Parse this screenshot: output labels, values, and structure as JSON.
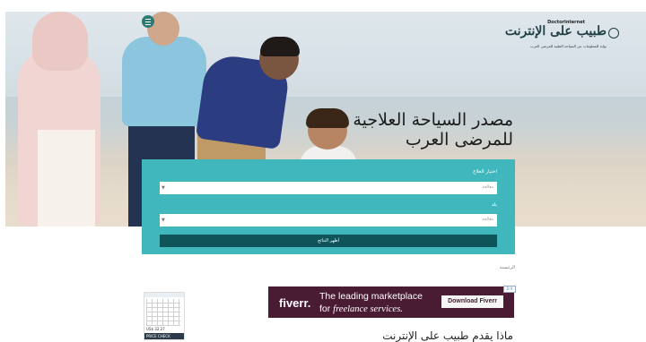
{
  "header": {
    "logo_en": "DoctorInternet",
    "logo_ar": "طبيب على الإنترنت",
    "tagline": "بوابة للمعلومات عن السياحة الطبية للمرضى العرب",
    "menu_icon": "hamburger-icon"
  },
  "hero": {
    "title_line1": "مصدر السياحة العلاجية",
    "title_line2": "للمرضى العرب"
  },
  "search": {
    "treatment_label": "اختيار العلاج",
    "treatment_placeholder": "معالجة",
    "country_label": "بلد",
    "country_placeholder": "معالجة",
    "submit_label": "أظهر النتائج",
    "caret_icon": "chevron-down-icon",
    "panel_color": "#3fb7bd",
    "button_color": "#0e5459"
  },
  "breadcrumb": "الرئيسية",
  "widget": {
    "price_text": "US$ 32.27",
    "bar_text": "PRICE CHECK"
  },
  "ad": {
    "brand": "fiverr.",
    "line1": "The leading marketplace",
    "line2_prefix": "for ",
    "line2_em": "freelance services.",
    "cta": "Download Fiverr",
    "choices": "D X",
    "bg_color": "#4a1c33"
  },
  "teaser": "ماذا يقدم طبيب على الإنترنت"
}
